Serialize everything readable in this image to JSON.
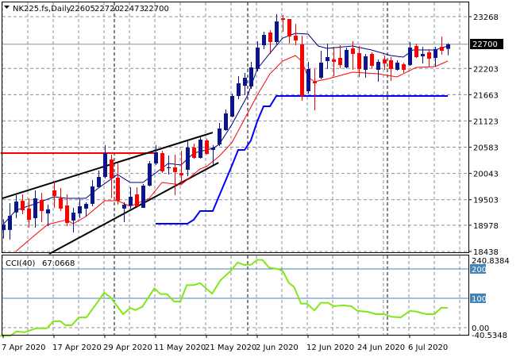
{
  "header": {
    "symbol_timeframe": "NK225.fs,Daily",
    "open": "22605",
    "high": "22720",
    "low": "22473",
    "close": "22700"
  },
  "cci_header": {
    "label": "CCI(40)",
    "value": "67.0668"
  },
  "current_price_label": "22700",
  "colors": {
    "bull": "#0a148c",
    "bear": "#ff0000",
    "ma_fast": "#00007f",
    "ma_slow": "#ff0000",
    "support_line": "#0000ff",
    "resistance_line": "#ff0000",
    "trendline": "#000000",
    "cci_line": "#7fe817",
    "cci_level": "#4682b4"
  },
  "chart_data": [
    {
      "type": "candlestick",
      "title": "NK225.fs,Daily",
      "price_axis": {
        "min": 18438,
        "max": 23268,
        "ticks": [
          "23268",
          "22203",
          "21663",
          "21123",
          "20583",
          "20043",
          "19503",
          "18978",
          "18438"
        ]
      },
      "date_labels": [
        {
          "index": 0,
          "text": "7 Apr 2020"
        },
        {
          "index": 8,
          "text": "17 Apr 2020"
        },
        {
          "index": 16,
          "text": "29 Apr 2020"
        },
        {
          "index": 24,
          "text": "11 May 2020"
        },
        {
          "index": 32,
          "text": "21 May 2020"
        },
        {
          "index": 40,
          "text": "2 Jun 2020"
        },
        {
          "index": 48,
          "text": "12 Jun 2020"
        },
        {
          "index": 56,
          "text": "24 Jun 2020"
        },
        {
          "index": 64,
          "text": "6 Jul 2020"
        }
      ],
      "period_separators": [
        18,
        39,
        61
      ],
      "candles_ohlc": [
        [
          18877,
          19100,
          18700,
          18992
        ],
        [
          18880,
          19430,
          18680,
          19170
        ],
        [
          19240,
          19596,
          19123,
          19465
        ],
        [
          19480,
          19612,
          19205,
          19286
        ],
        [
          19320,
          19531,
          18927,
          19090
        ],
        [
          19123,
          19694,
          18927,
          19531
        ],
        [
          19498,
          19645,
          19041,
          19270
        ],
        [
          19220,
          19400,
          18960,
          19303
        ],
        [
          19694,
          19890,
          19335,
          19580
        ],
        [
          19531,
          19743,
          19270,
          19320
        ],
        [
          19384,
          19612,
          18960,
          19025
        ],
        [
          19074,
          19335,
          18829,
          19237
        ],
        [
          19220,
          19515,
          19123,
          19368
        ],
        [
          19320,
          19450,
          19155,
          19417
        ],
        [
          19417,
          19906,
          19368,
          19776
        ],
        [
          19760,
          20102,
          19743,
          19971
        ],
        [
          19971,
          20624,
          19939,
          20461
        ],
        [
          20330,
          20428,
          19531,
          19939
        ],
        [
          19955,
          20265,
          19400,
          19482
        ],
        [
          19320,
          19450,
          19041,
          19400
        ],
        [
          19384,
          19760,
          19320,
          19564
        ],
        [
          19612,
          19760,
          19335,
          19368
        ],
        [
          19335,
          19825,
          19335,
          19792
        ],
        [
          19792,
          20298,
          19776,
          20249
        ],
        [
          20249,
          20624,
          20216,
          20478
        ],
        [
          20461,
          20510,
          20053,
          20086
        ],
        [
          20150,
          20412,
          20020,
          20170
        ],
        [
          20167,
          20428,
          19596,
          20070
        ],
        [
          20053,
          20510,
          19824,
          20004
        ],
        [
          20118,
          20706,
          19988,
          20575
        ],
        [
          20575,
          20657,
          20347,
          20363
        ],
        [
          20363,
          20787,
          20347,
          20738
        ],
        [
          20722,
          20760,
          20430,
          20445
        ],
        [
          20527,
          20624,
          20216,
          20575
        ],
        [
          20640,
          21081,
          20608,
          20967
        ],
        [
          20934,
          21359,
          20920,
          21277
        ],
        [
          21212,
          21685,
          21200,
          21636
        ],
        [
          21636,
          22044,
          21571,
          21897
        ],
        [
          21848,
          22109,
          21652,
          22011
        ],
        [
          21832,
          22338,
          21783,
          22224
        ],
        [
          22191,
          22762,
          22142,
          22632
        ],
        [
          22680,
          22958,
          22599,
          22893
        ],
        [
          22942,
          22991,
          22501,
          22746
        ],
        [
          22746,
          23317,
          22697,
          23170
        ],
        [
          23235,
          23300,
          22958,
          23203
        ],
        [
          23219,
          23219,
          22713,
          22860
        ],
        [
          22877,
          23121,
          22680,
          22778
        ],
        [
          22697,
          22877,
          21538,
          21636
        ],
        [
          21734,
          22338,
          21685,
          22191
        ],
        [
          21930,
          22191,
          21342,
          21897
        ],
        [
          22011,
          22566,
          21979,
          22322
        ],
        [
          22354,
          22713,
          22191,
          22436
        ],
        [
          22387,
          22648,
          22044,
          22338
        ],
        [
          22420,
          22680,
          22207,
          22273
        ],
        [
          22224,
          22632,
          22207,
          22583
        ],
        [
          22615,
          22762,
          22175,
          22501
        ],
        [
          22517,
          22664,
          22028,
          22191
        ],
        [
          22175,
          22501,
          22011,
          22452
        ],
        [
          22501,
          22534,
          22207,
          22256
        ],
        [
          22175,
          22387,
          21930,
          22338
        ],
        [
          22387,
          22468,
          22175,
          22305
        ],
        [
          22371,
          22436,
          21946,
          22191
        ],
        [
          22175,
          22371,
          22160,
          22322
        ],
        [
          22289,
          22322,
          22110,
          22175
        ],
        [
          22273,
          22746,
          22256,
          22632
        ],
        [
          22664,
          22713,
          22420,
          22436
        ],
        [
          22452,
          22648,
          22305,
          22501
        ],
        [
          22534,
          22599,
          22240,
          22403
        ],
        [
          22420,
          22648,
          22240,
          22599
        ],
        [
          22648,
          22860,
          22485,
          22566
        ],
        [
          22605,
          22720,
          22473,
          22700
        ]
      ],
      "ma_fast": [
        [
          0,
          18992
        ],
        [
          2,
          19286
        ],
        [
          5,
          19417
        ],
        [
          8,
          19564
        ],
        [
          10,
          19531
        ],
        [
          13,
          19531
        ],
        [
          15,
          19743
        ],
        [
          18,
          20020
        ],
        [
          20,
          19857
        ],
        [
          22,
          19857
        ],
        [
          25,
          20151
        ],
        [
          26,
          20249
        ],
        [
          28,
          20216
        ],
        [
          30,
          20461
        ],
        [
          33,
          20559
        ],
        [
          34,
          20640
        ],
        [
          36,
          21049
        ],
        [
          38.5,
          21652
        ],
        [
          40,
          22191
        ],
        [
          42,
          22517
        ],
        [
          44,
          22827
        ],
        [
          46,
          22925
        ],
        [
          48,
          22909
        ],
        [
          49.6,
          22664
        ],
        [
          51,
          22615
        ],
        [
          55,
          22664
        ],
        [
          58,
          22583
        ],
        [
          61,
          22468
        ],
        [
          63,
          22436
        ],
        [
          64.5,
          22583
        ],
        [
          68,
          22583
        ],
        [
          70,
          22664
        ]
      ],
      "ma_slow": [
        [
          2,
          18438
        ],
        [
          4,
          18666
        ],
        [
          7,
          18992
        ],
        [
          10,
          19090
        ],
        [
          11,
          19008
        ],
        [
          13,
          19155
        ],
        [
          16,
          19482
        ],
        [
          18,
          19482
        ],
        [
          20,
          19368
        ],
        [
          23,
          19531
        ],
        [
          25,
          19857
        ],
        [
          28,
          19808
        ],
        [
          31,
          20135
        ],
        [
          32,
          20184
        ],
        [
          34,
          20396
        ],
        [
          36,
          20673
        ],
        [
          38,
          21163
        ],
        [
          40,
          21652
        ],
        [
          42,
          22093
        ],
        [
          44,
          22354
        ],
        [
          46,
          22468
        ],
        [
          47,
          22354
        ],
        [
          48,
          22028
        ],
        [
          49,
          21930
        ],
        [
          51,
          21985
        ],
        [
          55,
          22126
        ],
        [
          59,
          22093
        ],
        [
          62,
          22028
        ],
        [
          65,
          22224
        ],
        [
          68,
          22240
        ],
        [
          70,
          22354
        ]
      ],
      "support_step_line": [
        [
          24,
          19008
        ],
        [
          29,
          19008
        ],
        [
          30,
          19090
        ],
        [
          31,
          19270
        ],
        [
          33,
          19270
        ],
        [
          36,
          20200
        ],
        [
          37,
          20526
        ],
        [
          38,
          20526
        ],
        [
          39,
          20722
        ],
        [
          40,
          21114
        ],
        [
          41,
          21424
        ],
        [
          42,
          21424
        ],
        [
          43,
          21636
        ],
        [
          70,
          21636
        ]
      ],
      "resistance_line": {
        "price": 20460,
        "from_index": -0.4,
        "to_index": 23.9
      },
      "trendlines": [
        {
          "name": "upper",
          "from": [
            -0.1,
            19531
          ],
          "to": [
            33,
            20885
          ]
        },
        {
          "name": "lower",
          "from": [
            7.25,
            18388
          ],
          "to": [
            33.9,
            20265
          ]
        }
      ]
    },
    {
      "type": "line",
      "title": "CCI(40) 67.0668",
      "axis": {
        "min": -40.5348,
        "max": 240.8384,
        "labels": [
          "240.8384",
          "200",
          "100",
          "0.00",
          "-40.5348"
        ]
      },
      "levels": [
        200,
        100
      ],
      "series": [
        {
          "name": "CCI(40)",
          "points": [
            [
              -0.5,
              -28
            ],
            [
              1.1,
              -28
            ],
            [
              2.1,
              -13
            ],
            [
              3.4,
              -16
            ],
            [
              5.2,
              -2
            ],
            [
              6.9,
              -2
            ],
            [
              7.9,
              22
            ],
            [
              9,
              22
            ],
            [
              9.8,
              8
            ],
            [
              10.8,
              8
            ],
            [
              11.9,
              35
            ],
            [
              13.1,
              35
            ],
            [
              14.8,
              85
            ],
            [
              15.9,
              119
            ],
            [
              16.9,
              103
            ],
            [
              18.9,
              46
            ],
            [
              20,
              67
            ],
            [
              20.8,
              60
            ],
            [
              21.9,
              71
            ],
            [
              23.8,
              134
            ],
            [
              24.8,
              114
            ],
            [
              25.8,
              114
            ],
            [
              26.9,
              89
            ],
            [
              27.9,
              89
            ],
            [
              28.9,
              145
            ],
            [
              30,
              145
            ],
            [
              31,
              152
            ],
            [
              32.9,
              116
            ],
            [
              34.2,
              161
            ],
            [
              35.8,
              193
            ],
            [
              36.9,
              222
            ],
            [
              37.9,
              214
            ],
            [
              39,
              214
            ],
            [
              40,
              231
            ],
            [
              40.8,
              231
            ],
            [
              41.9,
              204
            ],
            [
              43.2,
              200
            ],
            [
              44,
              193
            ],
            [
              45,
              152
            ],
            [
              45.8,
              139
            ],
            [
              46.9,
              82
            ],
            [
              47.8,
              82
            ],
            [
              49,
              59
            ],
            [
              50,
              85
            ],
            [
              51.1,
              85
            ],
            [
              52.1,
              73
            ],
            [
              53.5,
              76
            ],
            [
              54.8,
              73
            ],
            [
              55.8,
              57
            ],
            [
              57.4,
              54
            ],
            [
              58.7,
              46
            ],
            [
              60,
              46
            ],
            [
              61.1,
              37
            ],
            [
              62.6,
              35
            ],
            [
              64,
              57
            ],
            [
              65,
              55
            ],
            [
              66.6,
              46
            ],
            [
              67.9,
              46
            ],
            [
              69,
              68
            ],
            [
              70,
              67.0668
            ]
          ]
        }
      ]
    }
  ]
}
